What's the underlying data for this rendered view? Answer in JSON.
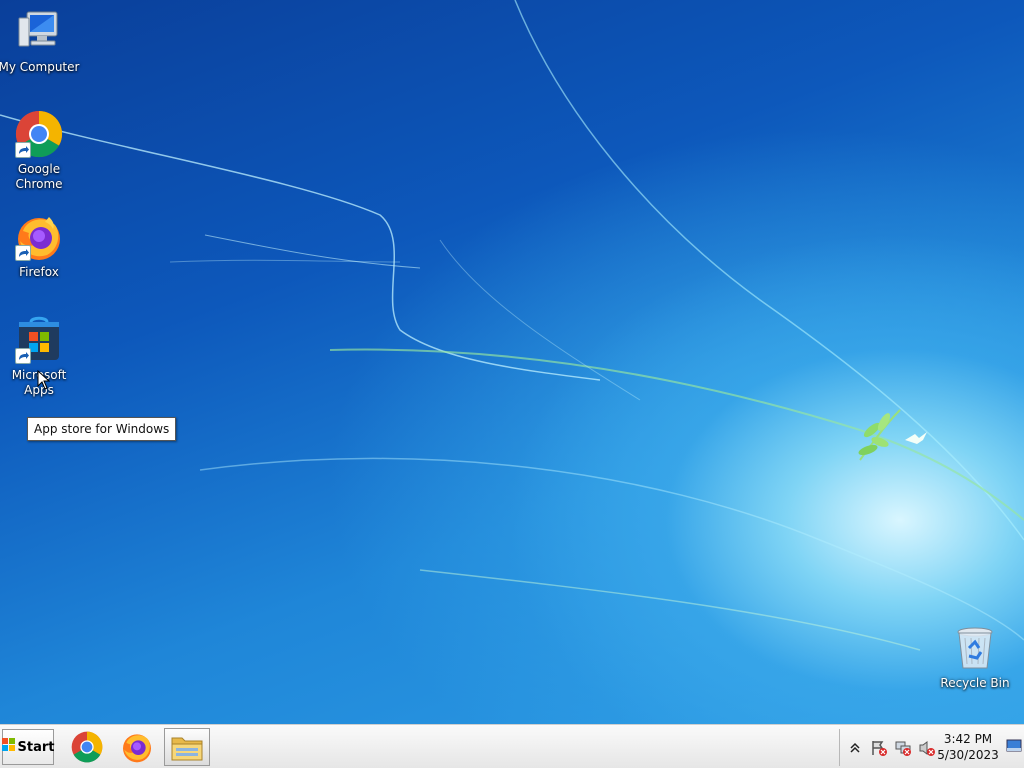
{
  "desktop": {
    "icons": [
      {
        "label": "My Computer",
        "icon": "computer-icon"
      },
      {
        "label": "Google Chrome",
        "icon": "chrome-icon"
      },
      {
        "label": "Firefox",
        "icon": "firefox-icon"
      },
      {
        "label": "Microsoft Apps",
        "icon": "microsoft-store-icon"
      },
      {
        "label": "Recycle Bin",
        "icon": "recycle-bin-icon"
      }
    ],
    "tooltip": "App store for Windows"
  },
  "taskbar": {
    "start_label": "Start",
    "pinned": [
      {
        "name": "Google Chrome",
        "icon": "chrome-icon"
      },
      {
        "name": "Firefox",
        "icon": "firefox-icon"
      },
      {
        "name": "File Explorer",
        "icon": "folder-icon"
      }
    ],
    "tray": {
      "icons": [
        "show-hidden-icons-icon",
        "action-center-flag-icon",
        "network-icon",
        "volume-icon"
      ],
      "time": "3:42 PM",
      "date": "5/30/2023"
    }
  },
  "colors": {
    "wallpaper_dark": "#0a3f9a",
    "wallpaper_light": "#d9f6ff",
    "taskbar": "#f0f0f0"
  }
}
